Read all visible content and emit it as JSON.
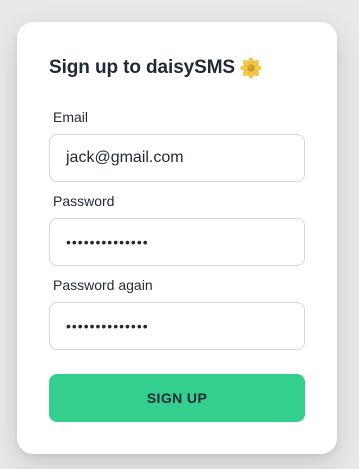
{
  "form": {
    "title": "Sign up to daisySMS",
    "title_icon": "daisy-flower-icon",
    "email_label": "Email",
    "email_value": "jack@gmail.com",
    "password_label": "Password",
    "password_value": "••••••••••••••",
    "password_again_label": "Password again",
    "password_again_value": "••••••••••••••",
    "submit_label": "SIGN UP"
  },
  "colors": {
    "background": "#e9e9ea",
    "card": "#ffffff",
    "button": "#34ce8e",
    "text": "#1f2937",
    "input_border": "#d1d5db"
  }
}
